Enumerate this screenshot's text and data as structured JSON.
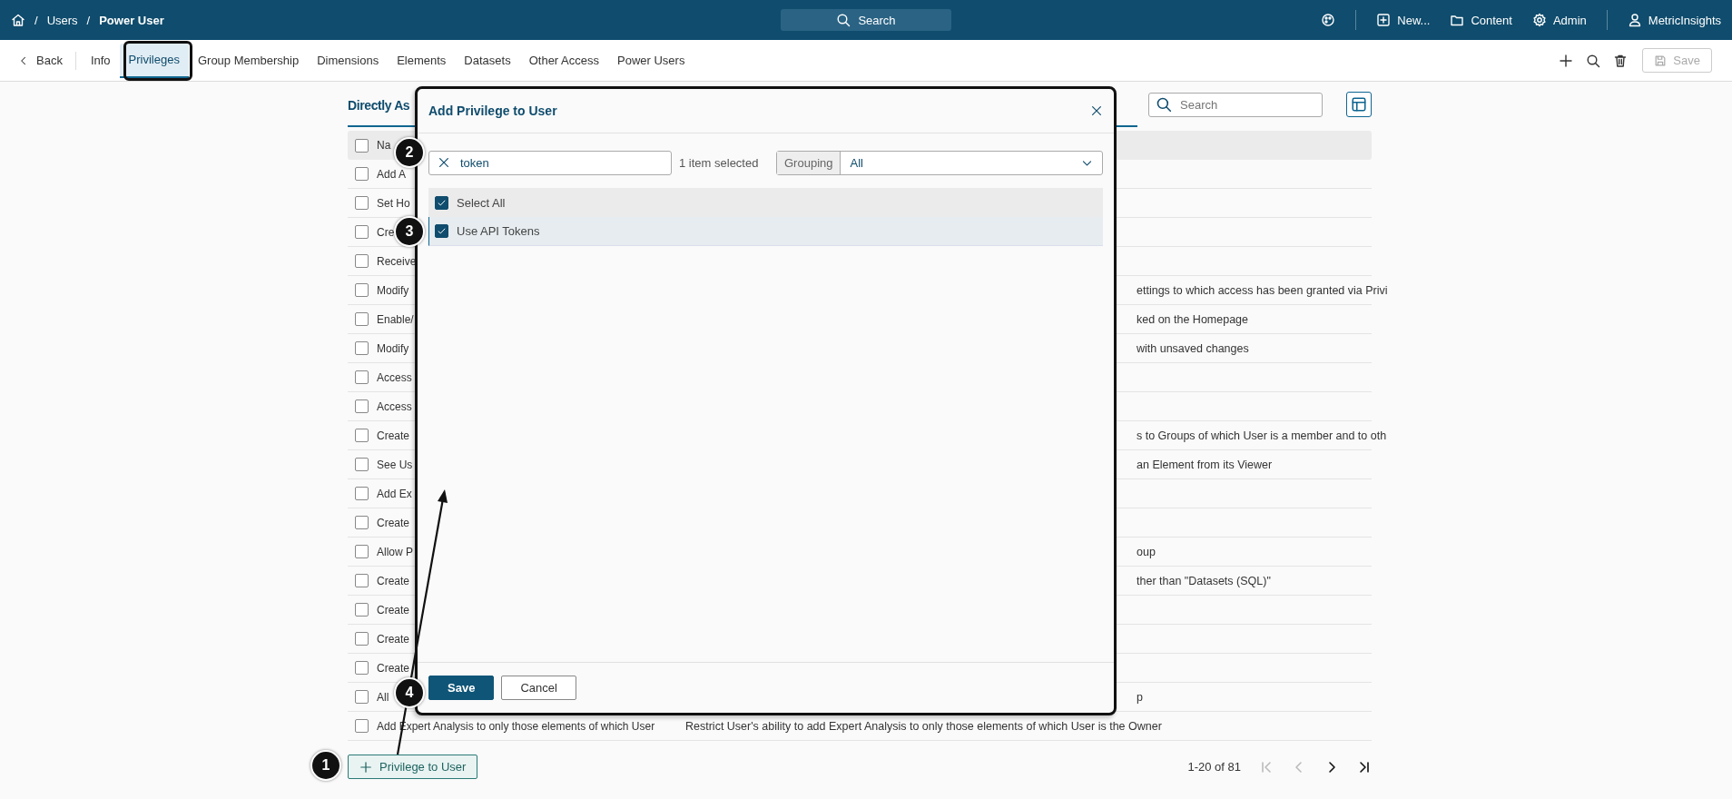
{
  "topbar": {
    "breadcrumb": [
      {
        "separator": "/",
        "label": "Users"
      },
      {
        "separator": "/",
        "label": "Power User"
      }
    ],
    "search": {
      "placeholder": "Search"
    },
    "menu": [
      {
        "label": "New...",
        "kind": "new"
      },
      {
        "label": "Content",
        "kind": "content"
      },
      {
        "label": "Admin",
        "kind": "admin"
      },
      {
        "label": "MetricInsights",
        "kind": "user"
      }
    ]
  },
  "back": {
    "label": "Back"
  },
  "tabs": [
    {
      "label": "Info",
      "selected": false
    },
    {
      "label": "Privileges",
      "selected": true
    },
    {
      "label": "Group Membership",
      "selected": false
    },
    {
      "label": "Dimensions",
      "selected": false
    },
    {
      "label": "Elements",
      "selected": false
    },
    {
      "label": "Datasets",
      "selected": false
    },
    {
      "label": "Other Access",
      "selected": false
    },
    {
      "label": "Power Users",
      "selected": false
    }
  ],
  "save_button": {
    "label": "Save",
    "disabled": true
  },
  "section": {
    "title": "Directly As",
    "search": {
      "placeholder": "Search"
    }
  },
  "table": {
    "header": "Na",
    "header_checked": false,
    "rows": [
      {
        "name": "Add A",
        "description": "",
        "checked": false
      },
      {
        "name": "Set Ho",
        "description": "",
        "checked": false
      },
      {
        "name": "Cre",
        "description": "",
        "checked": false
      },
      {
        "name": "Receive",
        "description": "",
        "checked": false
      },
      {
        "name": "Modify",
        "description": "ettings to which access has been granted via Privi",
        "checked": false
      },
      {
        "name": "Enable/",
        "description": "ked on the Homepage",
        "checked": false
      },
      {
        "name": "Modify",
        "description": "with unsaved changes",
        "checked": false
      },
      {
        "name": "Access",
        "description": "",
        "checked": false
      },
      {
        "name": "Access",
        "description": "",
        "checked": false
      },
      {
        "name": "Create",
        "description": "s to Groups of which User is a member and to oth",
        "checked": false
      },
      {
        "name": "See Us",
        "description": "an Element from its Viewer",
        "checked": false
      },
      {
        "name": "Add Ex",
        "description": "",
        "checked": false
      },
      {
        "name": "Create",
        "description": "",
        "checked": false
      },
      {
        "name": "Allow P",
        "description": "oup",
        "checked": false
      },
      {
        "name": "Create",
        "description": "ther than \"Datasets (SQL)\"",
        "checked": false
      },
      {
        "name": "Create",
        "description": "",
        "checked": false
      },
      {
        "name": "Create",
        "description": "",
        "checked": false
      },
      {
        "name": "Create",
        "description": "",
        "checked": false
      },
      {
        "name": "All",
        "description": "p",
        "checked": false
      },
      {
        "name": "Add Expert Analysis to only those elements of which User",
        "description": "Restrict User's ability to add Expert Analysis to only those elements of which User is the Owner",
        "checked": false,
        "kind": "full"
      }
    ]
  },
  "add_button": {
    "label": "Privilege to User"
  },
  "pagination": {
    "range": "1-20 of 81",
    "buttons": [
      {
        "kind": "first",
        "disabled": true
      },
      {
        "kind": "prev",
        "disabled": true
      },
      {
        "kind": "next",
        "disabled": false
      },
      {
        "kind": "last",
        "disabled": false
      }
    ]
  },
  "modal": {
    "title": "Add Privilege to User",
    "search": {
      "value": "token"
    },
    "selected_count": "1 item selected",
    "grouping": {
      "label": "Grouping",
      "value": "All"
    },
    "items": [
      {
        "label": "Select All",
        "checked": true,
        "selected": false,
        "kind": "select_all"
      },
      {
        "label": "Use API Tokens",
        "checked": true,
        "selected": true,
        "kind": "item"
      }
    ],
    "buttons": [
      {
        "label": "Save",
        "kind": "primary"
      },
      {
        "label": "Cancel",
        "kind": "secondary"
      }
    ]
  },
  "callouts": [
    {
      "number": "1"
    },
    {
      "number": "2"
    },
    {
      "number": "3"
    },
    {
      "number": "4"
    }
  ]
}
